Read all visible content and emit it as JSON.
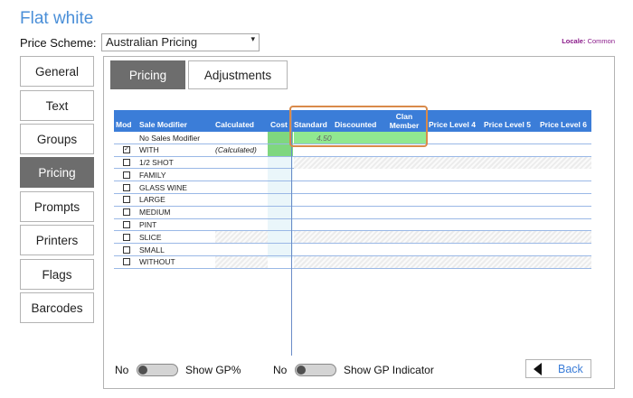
{
  "page_title": "Flat white",
  "price_scheme": {
    "label": "Price Scheme:",
    "value": "Australian Pricing"
  },
  "locale": {
    "label": "Locale:",
    "value": "Common"
  },
  "nav": [
    {
      "label": "General"
    },
    {
      "label": "Text"
    },
    {
      "label": "Groups"
    },
    {
      "label": "Pricing",
      "active": true
    },
    {
      "label": "Prompts"
    },
    {
      "label": "Printers"
    },
    {
      "label": "Flags"
    },
    {
      "label": "Barcodes"
    }
  ],
  "tabs": [
    {
      "label": "Pricing",
      "active": true
    },
    {
      "label": "Adjustments"
    }
  ],
  "grid": {
    "columns": {
      "mod": "Mod",
      "sale_modifier": "Sale Modifier",
      "calculated": "Calculated",
      "cost": "Cost",
      "standard": "Standard",
      "discounted": "Discounted",
      "clan_member_1": "Clan",
      "clan_member_2": "Member",
      "price_level_4": "Price Level 4",
      "price_level_5": "Price Level 5",
      "price_level_6": "Price Level 6"
    },
    "rows": [
      {
        "checked": null,
        "name": "No Sales Modifier",
        "calculated": "",
        "standard": "4.50"
      },
      {
        "checked": true,
        "name": "WITH",
        "calculated": "(Calculated)",
        "standard": ""
      },
      {
        "checked": false,
        "name": "1/2 SHOT",
        "calculated": "",
        "standard": ""
      },
      {
        "checked": false,
        "name": "FAMILY",
        "calculated": "",
        "standard": ""
      },
      {
        "checked": false,
        "name": "GLASS WINE",
        "calculated": "",
        "standard": ""
      },
      {
        "checked": false,
        "name": "LARGE",
        "calculated": "",
        "standard": ""
      },
      {
        "checked": false,
        "name": "MEDIUM",
        "calculated": "",
        "standard": ""
      },
      {
        "checked": false,
        "name": "PINT",
        "calculated": "",
        "standard": ""
      },
      {
        "checked": false,
        "name": "SLICE",
        "calculated": "",
        "standard": ""
      },
      {
        "checked": false,
        "name": "SMALL",
        "calculated": "",
        "standard": ""
      },
      {
        "checked": false,
        "name": "WITHOUT",
        "calculated": "",
        "standard": ""
      }
    ]
  },
  "bottom": {
    "gp_toggle": {
      "state": "No",
      "label": "Show GP%"
    },
    "gp_indicator_toggle": {
      "state": "No",
      "label": "Show GP Indicator"
    },
    "back_label": "Back"
  },
  "colors": {
    "accent": "#3b7dd8",
    "highlight": "#d98a4a",
    "active_nav": "#6d6d6d",
    "price_cell": "#90e890"
  },
  "icons": {
    "back": "triangle-left-icon",
    "dropdown": "caret-down-icon",
    "checkbox_checked": "check-icon"
  }
}
